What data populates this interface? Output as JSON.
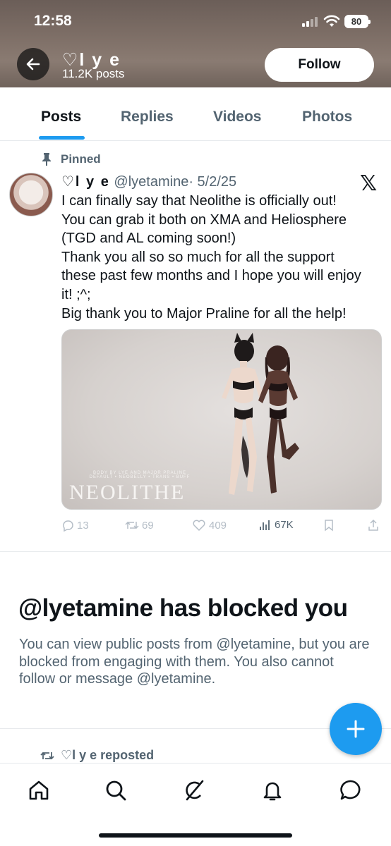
{
  "status_bar": {
    "time": "12:58",
    "battery": "80"
  },
  "header": {
    "name": "♡l y e",
    "post_count": "11.2K posts",
    "follow_label": "Follow"
  },
  "tabs": [
    {
      "label": "Posts",
      "active": true
    },
    {
      "label": "Replies",
      "active": false
    },
    {
      "label": "Videos",
      "active": false
    },
    {
      "label": "Photos",
      "active": false
    }
  ],
  "pinned_post": {
    "pinned_label": "Pinned",
    "author_name": "♡l y e",
    "handle": "@lyetamine",
    "date": "· 5/2/25",
    "text_lines": [
      "I can finally say that Neolithe is officially out!",
      "You can grab it both on XMA and Heliosphere",
      "(TGD and AL coming soon!)",
      "Thank you all so so much for all the support",
      "these past few months and I hope you will enjoy",
      "it! ;^;",
      "Big thank you to Major Praline for all the help!"
    ],
    "media": {
      "subtitle_line1": "BODY BY LYE AND MAJOR PRALINE",
      "subtitle_line2": "DEFAULT • NEOBELLY • TRANS • BUFF",
      "title": "NEOLITHE"
    },
    "stats": {
      "replies": "13",
      "reposts": "69",
      "likes": "409",
      "views": "67K"
    }
  },
  "blocked": {
    "title": "@lyetamine has blocked you",
    "body": "You can view public posts from @lyetamine, but you are blocked from engaging with them. You also cannot follow or message @lyetamine."
  },
  "repost_notice": "♡l y e reposted",
  "colors": {
    "accent": "#1d9bf0",
    "text_primary": "#0f1419",
    "text_secondary": "#536471"
  },
  "icons": {
    "back": "arrow-left-icon",
    "pin": "pin-icon",
    "x": "x-logo-icon",
    "reply": "reply-icon",
    "repost": "repost-icon",
    "like": "heart-icon",
    "views": "views-icon",
    "bookmark": "bookmark-icon",
    "share": "share-icon",
    "compose": "plus-icon",
    "nav": [
      "home-icon",
      "search-icon",
      "grok-icon",
      "bell-icon",
      "messages-icon"
    ]
  }
}
